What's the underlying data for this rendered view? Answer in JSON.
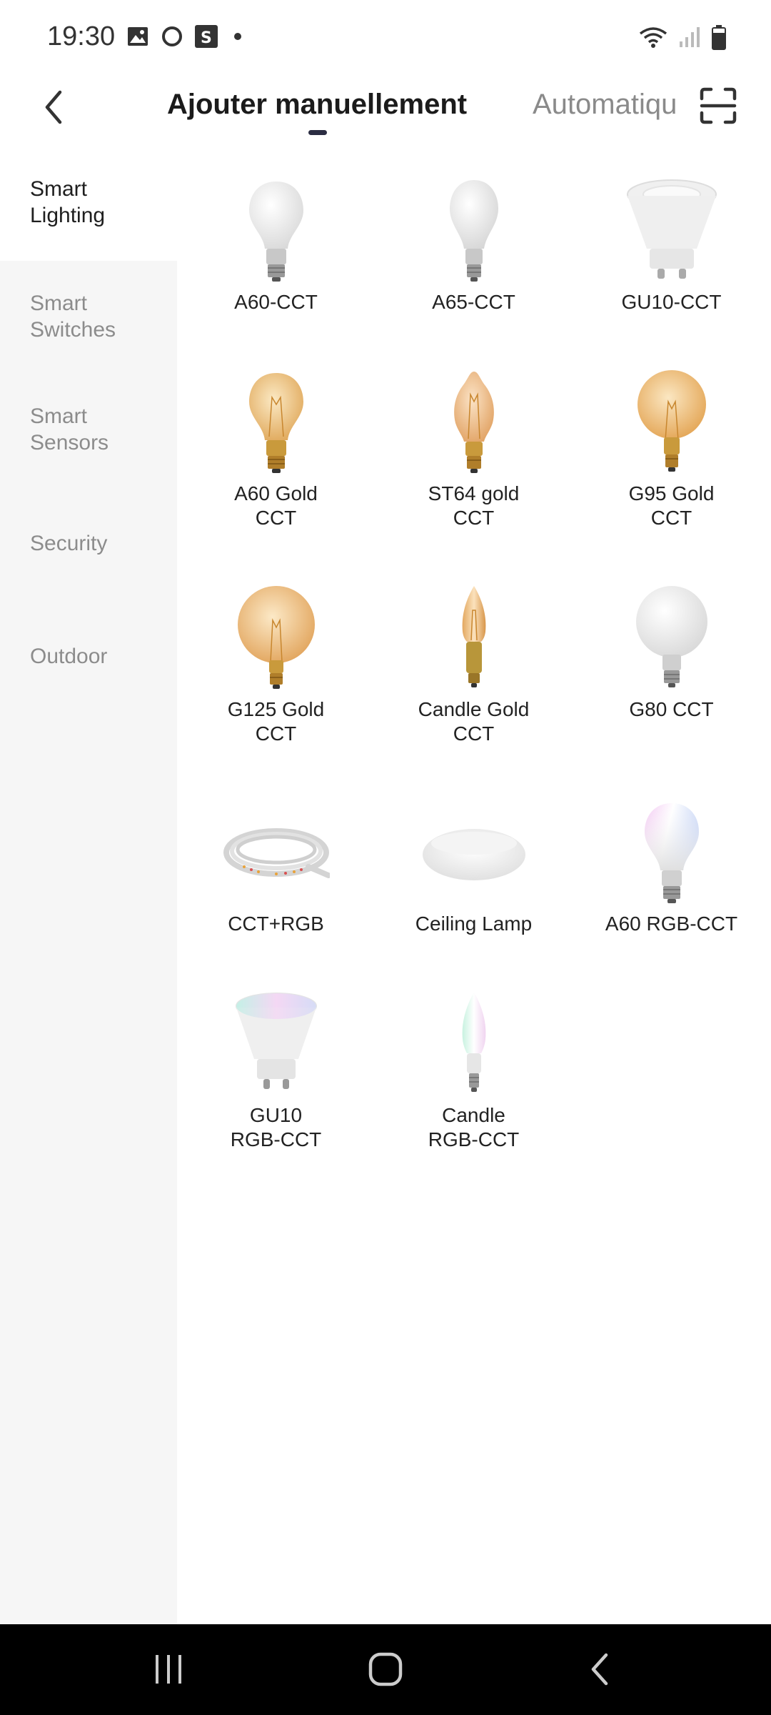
{
  "status_bar": {
    "time": "19:30",
    "left_icons": [
      "gallery-icon",
      "circle-app-icon",
      "s-app-icon"
    ],
    "right_icons": [
      "wifi-icon",
      "signal-icon",
      "battery-icon"
    ]
  },
  "header": {
    "tab_manual": "Ajouter manuellement",
    "tab_auto": "Automatique",
    "back_icon": "chevron-left-icon",
    "scan_icon": "scan-icon"
  },
  "sidebar": {
    "items": [
      {
        "label": "Smart\nLighting",
        "active": true
      },
      {
        "label": "Smart\nSwitches",
        "active": false
      },
      {
        "label": "Smart\nSensors",
        "active": false
      },
      {
        "label": "Security",
        "active": false
      },
      {
        "label": "Outdoor",
        "active": false
      }
    ]
  },
  "products": [
    {
      "name": "A60-CCT",
      "icon": "bulb-a60-white-icon"
    },
    {
      "name": "A65-CCT",
      "icon": "bulb-a65-white-icon"
    },
    {
      "name": "GU10-CCT",
      "icon": "spot-gu10-white-icon"
    },
    {
      "name": "A60 Gold\nCCT",
      "icon": "bulb-a60-gold-icon"
    },
    {
      "name": "ST64 gold\nCCT",
      "icon": "bulb-st64-gold-icon"
    },
    {
      "name": "G95 Gold\nCCT",
      "icon": "bulb-g95-gold-icon"
    },
    {
      "name": "G125 Gold\nCCT",
      "icon": "bulb-g125-gold-icon"
    },
    {
      "name": "Candle Gold\nCCT",
      "icon": "candle-gold-icon"
    },
    {
      "name": "G80 CCT",
      "icon": "bulb-g80-white-icon"
    },
    {
      "name": "CCT+RGB",
      "icon": "led-strip-icon"
    },
    {
      "name": "Ceiling Lamp",
      "icon": "ceiling-lamp-icon"
    },
    {
      "name": "A60 RGB-CCT",
      "icon": "bulb-a60-rgb-icon"
    },
    {
      "name": "GU10\nRGB-CCT",
      "icon": "spot-gu10-rgb-icon"
    },
    {
      "name": "Candle\nRGB-CCT",
      "icon": "candle-rgb-icon"
    }
  ],
  "nav_bar": {
    "recent_icon": "recent-apps-icon",
    "home_icon": "home-icon",
    "back_icon": "back-nav-icon"
  }
}
